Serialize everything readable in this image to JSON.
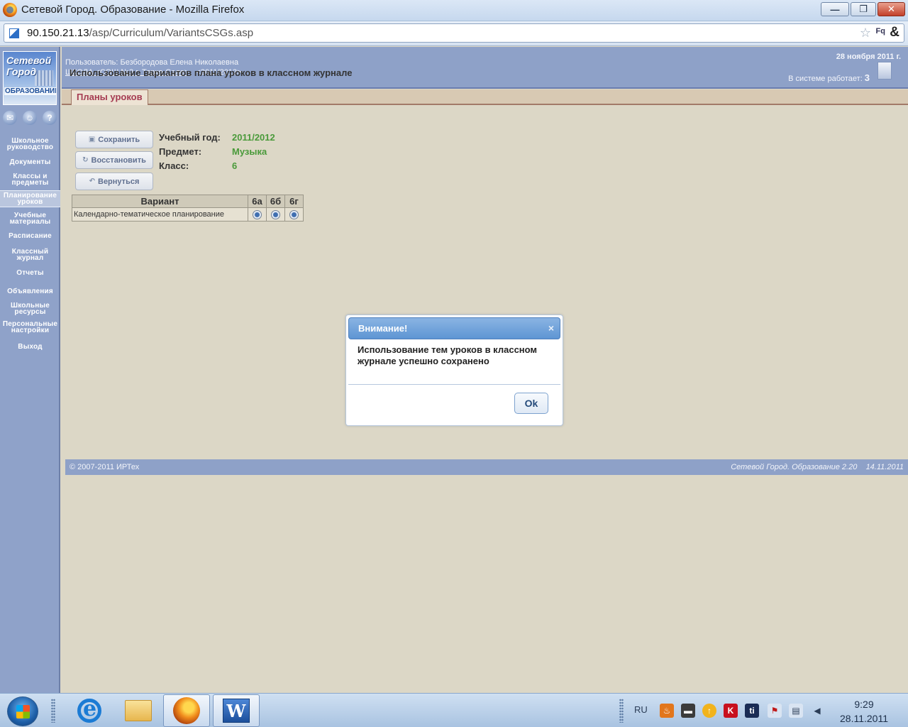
{
  "window": {
    "title": "Сетевой Город. Образование - Mozilla Firefox",
    "url_host": "90.150.21.13",
    "url_path": "/asp/Curriculum/VariantsCSGs.asp",
    "btn_minimize": "—",
    "btn_maximize": "❐",
    "btn_close": "✕",
    "addon_label": "Fq",
    "amp_label": "&"
  },
  "logo": {
    "line1": "Сетевой",
    "line2": "Город",
    "line3": "ОБРАЗОВАНИЕ"
  },
  "side_icons": {
    "mail": "✉",
    "users": "☺",
    "help": "?"
  },
  "sidebar": {
    "items": [
      {
        "label": "Школьное руководство"
      },
      {
        "label": "Документы"
      },
      {
        "label": "Классы и предметы"
      },
      {
        "label": "Планирование уроков"
      },
      {
        "label": "Учебные материалы"
      },
      {
        "label": "Расписание"
      },
      {
        "label": "Классный журнал"
      },
      {
        "label": "Отчеты"
      },
      {
        "label": "Объявления"
      },
      {
        "label": "Школьные ресурсы"
      },
      {
        "label": "Персональные настройки"
      },
      {
        "label": "Выход"
      }
    ]
  },
  "header": {
    "user_line": "Пользователь: Безбородова Елена Николаевна",
    "school_link": "ШКОЛА <СОШ №3 г. Тарко-Сале>,",
    "year": "<2011/2012>",
    "date": "28 ноября 2011 г.",
    "online_label": "В системе работает:",
    "online_count": "3"
  },
  "tab": {
    "label": "Планы уроков"
  },
  "main": {
    "title": "Использование вариантов плана уроков в классном журнале",
    "buttons": {
      "save": "Сохранить",
      "restore": "Восстановить",
      "back": "Вернуться"
    },
    "info": {
      "year_label": "Учебный год:",
      "year_value": "2011/2012",
      "subject_label": "Предмет:",
      "subject_value": "Музыка",
      "class_label": "Класс:",
      "class_value": "6"
    },
    "table": {
      "headers": [
        "Вариант",
        "6а",
        "6б",
        "6г"
      ],
      "rows": [
        {
          "variant": "Календарно-тематическое планирование",
          "selected": [
            true,
            true,
            true
          ]
        }
      ]
    }
  },
  "footer": {
    "copyright": "© 2007-2011 ИРТех",
    "version": "Сетевой Город. Образование 2.20    14.11.2011"
  },
  "dialog": {
    "title": "Внимание!",
    "message": "Использование тем уроков в классном журнале успешно сохранено",
    "ok": "Ok",
    "close": "×"
  },
  "taskbar": {
    "word_label": "W",
    "language": "RU",
    "time": "9:29",
    "date": "28.11.2011"
  }
}
